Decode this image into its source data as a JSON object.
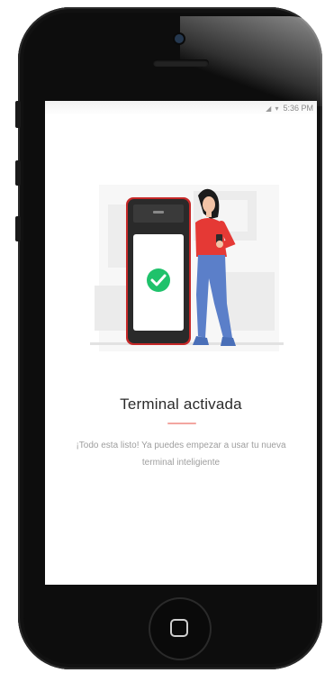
{
  "status_bar": {
    "icons": "◢ ▾",
    "time": "5:36 PM"
  },
  "content": {
    "title": "Terminal activada",
    "description": "¡Todo esta listo! Ya puedes empezar a usar tu nueva terminal inteligiente"
  },
  "colors": {
    "accent": "#e53935",
    "success": "#1fc26b",
    "trouser": "#5b7fc9"
  },
  "icons": [
    "camera-icon",
    "check-icon",
    "home-icon",
    "signal-icon",
    "wifi-icon"
  ]
}
